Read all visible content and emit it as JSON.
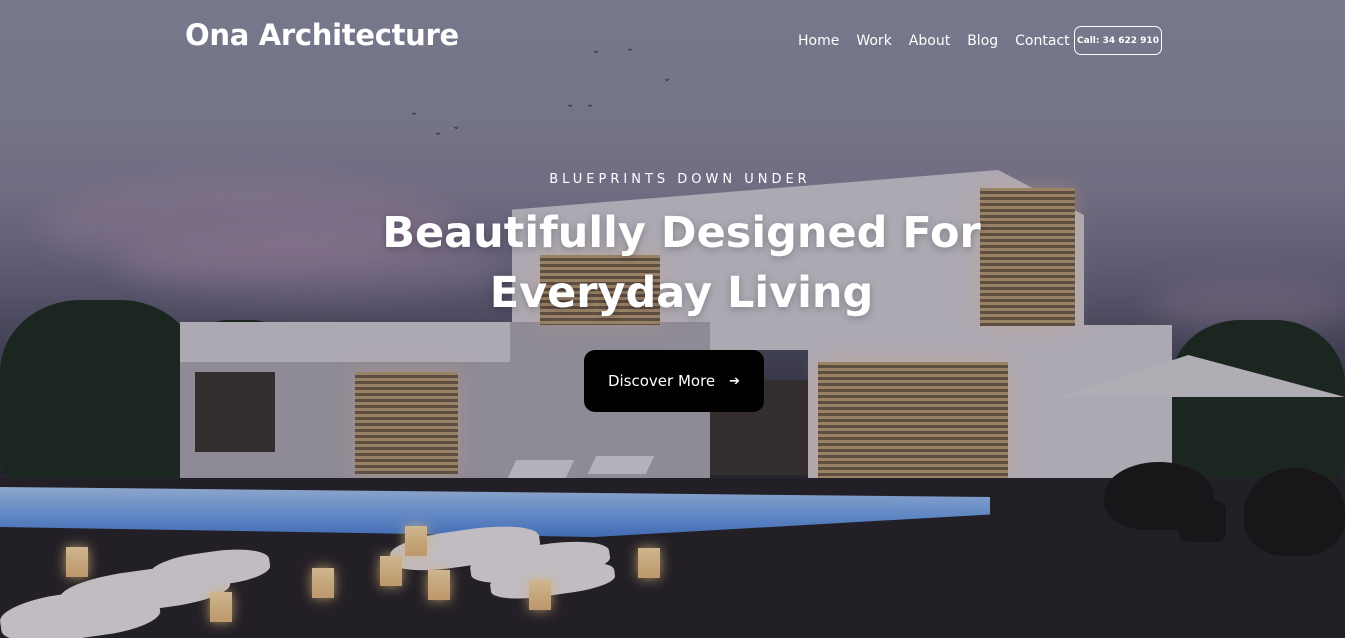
{
  "brand": {
    "name": "Ona Architecture"
  },
  "nav": {
    "items": [
      "Home",
      "Work",
      "About",
      "Blog",
      "Contact"
    ]
  },
  "call_button": {
    "label": "Call: 34 622 910"
  },
  "hero": {
    "eyebrow": "BLUEPRINTS DOWN UNDER",
    "headline_line1": "Beautifully Designed For",
    "headline_line2": "Everyday Living",
    "cta_label": "Discover More",
    "cta_icon": "arrow-right-icon"
  },
  "colors": {
    "text": "#ffffff",
    "cta_background": "#000000"
  }
}
